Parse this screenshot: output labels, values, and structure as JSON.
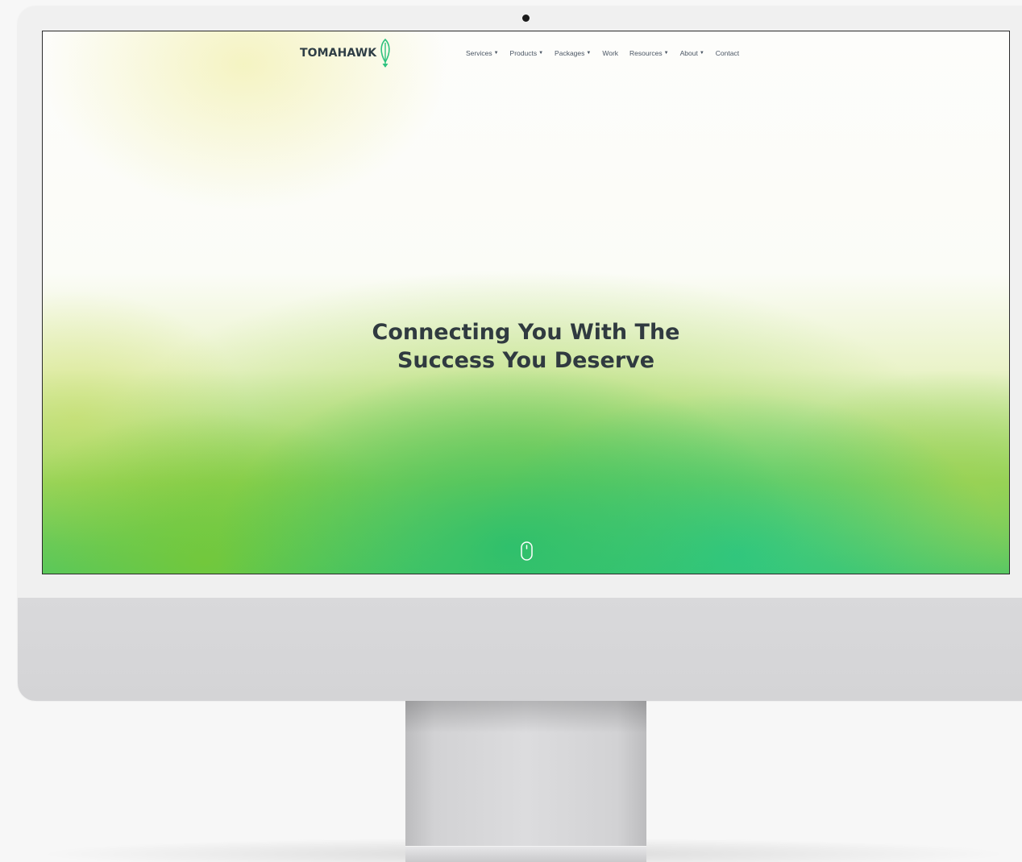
{
  "brand": {
    "name": "TOMAHAWK",
    "logo_icon": "feather-icon",
    "colors": {
      "logo_text": "#2f3e46",
      "logo_icon": "#2ec27e",
      "headline": "#303a40",
      "nav_text": "#4a5563"
    }
  },
  "nav": {
    "items": [
      {
        "label": "Services",
        "has_dropdown": true
      },
      {
        "label": "Products",
        "has_dropdown": true
      },
      {
        "label": "Packages",
        "has_dropdown": true
      },
      {
        "label": "Work",
        "has_dropdown": false
      },
      {
        "label": "Resources",
        "has_dropdown": true
      },
      {
        "label": "About",
        "has_dropdown": true
      },
      {
        "label": "Contact",
        "has_dropdown": false
      }
    ],
    "dropdown_icon": "caret-down-icon"
  },
  "hero": {
    "headline_line1": "Connecting You With The",
    "headline_line2": "Success You Deserve",
    "scroll_icon": "mouse-scroll-icon"
  },
  "device": {
    "frame_icon": "imac-frame",
    "camera_icon": "camera-dot-icon"
  }
}
